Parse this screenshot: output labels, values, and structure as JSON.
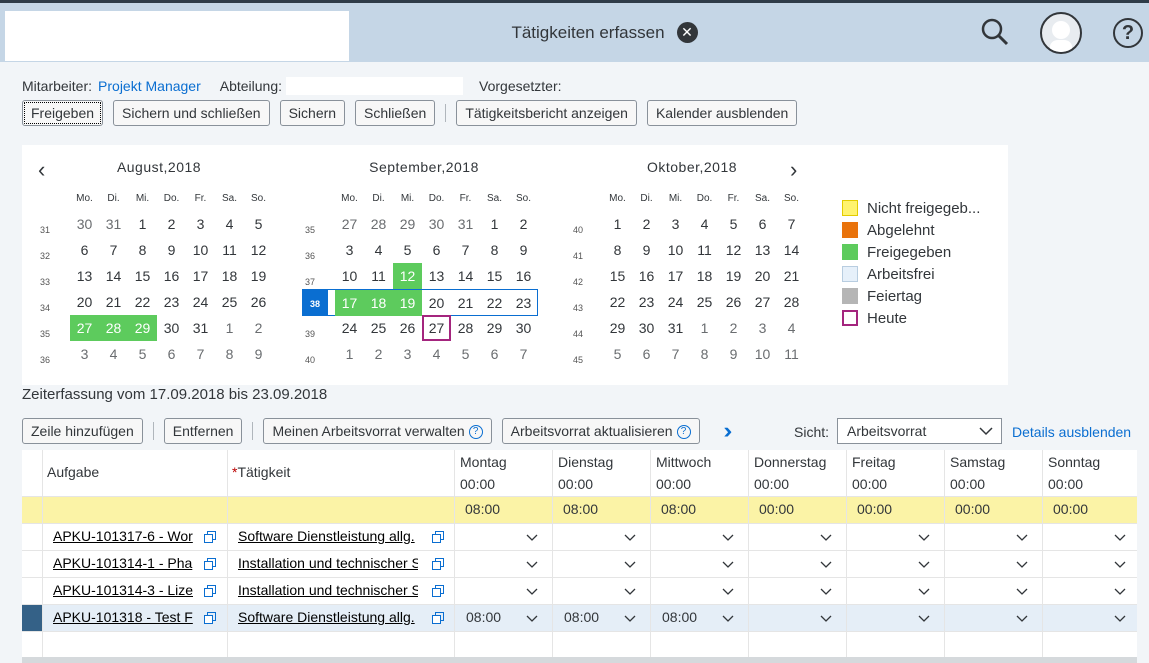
{
  "header": {
    "title": "Tätigkeiten erfassen",
    "icons": [
      "close-icon",
      "search-icon",
      "avatar",
      "help-icon"
    ]
  },
  "info": {
    "employee_label": "Mitarbeiter:",
    "employee_value": "Projekt Manager",
    "department_label": "Abteilung:",
    "supervisor_label": "Vorgesetzter:"
  },
  "toolbar": {
    "release": "Freigeben",
    "save_close": "Sichern und schließen",
    "save": "Sichern",
    "close": "Schließen",
    "report": "Tätigkeitsbericht anzeigen",
    "hide_calendar": "Kalender ausblenden"
  },
  "calendar": {
    "weekday_headers": [
      "Mo.",
      "Di.",
      "Mi.",
      "Do.",
      "Fr.",
      "Sa.",
      "So."
    ],
    "months": [
      {
        "title": "August,2018",
        "weeks": [
          {
            "wk": "31",
            "days": [
              "30",
              "31",
              "1",
              "2",
              "3",
              "4",
              "5"
            ],
            "other": [
              0,
              1
            ]
          },
          {
            "wk": "32",
            "days": [
              "6",
              "7",
              "8",
              "9",
              "10",
              "11",
              "12"
            ],
            "other": []
          },
          {
            "wk": "33",
            "days": [
              "13",
              "14",
              "15",
              "16",
              "17",
              "18",
              "19"
            ],
            "other": []
          },
          {
            "wk": "34",
            "days": [
              "20",
              "21",
              "22",
              "23",
              "24",
              "25",
              "26"
            ],
            "other": []
          },
          {
            "wk": "35",
            "days": [
              "27",
              "28",
              "29",
              "30",
              "31",
              "1",
              "2"
            ],
            "other": [
              5,
              6
            ],
            "green": [
              0,
              1,
              2
            ]
          },
          {
            "wk": "36",
            "days": [
              "3",
              "4",
              "5",
              "6",
              "7",
              "8",
              "9"
            ],
            "other": [
              0,
              1,
              2,
              3,
              4,
              5,
              6
            ]
          }
        ]
      },
      {
        "title": "September,2018",
        "weeks": [
          {
            "wk": "35",
            "days": [
              "27",
              "28",
              "29",
              "30",
              "31",
              "1",
              "2"
            ],
            "other": [
              0,
              1,
              2,
              3,
              4
            ]
          },
          {
            "wk": "36",
            "days": [
              "3",
              "4",
              "5",
              "6",
              "7",
              "8",
              "9"
            ],
            "other": []
          },
          {
            "wk": "37",
            "days": [
              "10",
              "11",
              "12",
              "13",
              "14",
              "15",
              "16"
            ],
            "other": [],
            "green": [
              2
            ]
          },
          {
            "wk": "38",
            "days": [
              "17",
              "18",
              "19",
              "20",
              "21",
              "22",
              "23"
            ],
            "other": [],
            "green": [
              0,
              1,
              2
            ],
            "selected": true
          },
          {
            "wk": "39",
            "days": [
              "24",
              "25",
              "26",
              "27",
              "28",
              "29",
              "30"
            ],
            "other": [],
            "today": 3
          },
          {
            "wk": "40",
            "days": [
              "1",
              "2",
              "3",
              "4",
              "5",
              "6",
              "7"
            ],
            "other": [
              0,
              1,
              2,
              3,
              4,
              5,
              6
            ]
          }
        ]
      },
      {
        "title": "Oktober,2018",
        "weeks": [
          {
            "wk": "40",
            "days": [
              "1",
              "2",
              "3",
              "4",
              "5",
              "6",
              "7"
            ],
            "other": []
          },
          {
            "wk": "41",
            "days": [
              "8",
              "9",
              "10",
              "11",
              "12",
              "13",
              "14"
            ],
            "other": []
          },
          {
            "wk": "42",
            "days": [
              "15",
              "16",
              "17",
              "18",
              "19",
              "20",
              "21"
            ],
            "other": []
          },
          {
            "wk": "43",
            "days": [
              "22",
              "23",
              "24",
              "25",
              "26",
              "27",
              "28"
            ],
            "other": []
          },
          {
            "wk": "44",
            "days": [
              "29",
              "30",
              "31",
              "1",
              "2",
              "3",
              "4"
            ],
            "other": [
              3,
              4,
              5,
              6
            ]
          },
          {
            "wk": "45",
            "days": [
              "5",
              "6",
              "7",
              "8",
              "9",
              "10",
              "11"
            ],
            "other": [
              0,
              1,
              2,
              3,
              4,
              5,
              6
            ]
          }
        ]
      }
    ],
    "legend": [
      {
        "label": "Nicht freigegeb...",
        "color": "#fff36e",
        "border": "#e3cc00"
      },
      {
        "label": "Abgelehnt",
        "color": "#e9730c",
        "border": "#e9730c"
      },
      {
        "label": "Freigegeben",
        "color": "#5dcb5d",
        "border": "#5dcb5d"
      },
      {
        "label": "Arbeitsfrei",
        "color": "#e6f0fa",
        "border": "#b8cde0"
      },
      {
        "label": "Feiertag",
        "color": "#b5b5b5",
        "border": "#b5b5b5"
      },
      {
        "label": "Heute",
        "color": "#ffffff",
        "border": "#a4257e"
      }
    ]
  },
  "period": "Zeiterfassung vom 17.09.2018 bis 23.09.2018",
  "toolbar2": {
    "add_row": "Zeile hinzufügen",
    "remove": "Entfernen",
    "manage": "Meinen Arbeitsvorrat verwalten",
    "refresh": "Arbeitsvorrat aktualisieren",
    "view_label": "Sicht:",
    "view_value": "Arbeitsvorrat",
    "details": "Details ausblenden"
  },
  "table": {
    "col_task": "Aufgabe",
    "col_activity": "Tätigkeit",
    "required_marker": "*",
    "days": [
      {
        "name": "Montag",
        "time": "00:00",
        "target": "08:00"
      },
      {
        "name": "Dienstag",
        "time": "00:00",
        "target": "08:00"
      },
      {
        "name": "Mittwoch",
        "time": "00:00",
        "target": "08:00"
      },
      {
        "name": "Donnerstag",
        "time": "00:00",
        "target": "00:00"
      },
      {
        "name": "Freitag",
        "time": "00:00",
        "target": "00:00"
      },
      {
        "name": "Samstag",
        "time": "00:00",
        "target": "00:00"
      },
      {
        "name": "Sonntag",
        "time": "00:00",
        "target": "00:00"
      }
    ],
    "rows": [
      {
        "task": "APKU-101317-6 - Wor",
        "activity": "Software Dienstleistung allg.",
        "values": [
          "",
          "",
          "",
          "",
          "",
          "",
          ""
        ]
      },
      {
        "task": "APKU-101314-1 - Pha",
        "activity": "Installation und technischer S",
        "values": [
          "",
          "",
          "",
          "",
          "",
          "",
          ""
        ]
      },
      {
        "task": "APKU-101314-3 - Lize",
        "activity": "Installation und technischer S",
        "values": [
          "",
          "",
          "",
          "",
          "",
          "",
          ""
        ]
      },
      {
        "task": "APKU-101318 - Test F",
        "activity": "Software Dienstleistung allg.",
        "values": [
          "08:00",
          "08:00",
          "08:00",
          "",
          "",
          "",
          ""
        ],
        "selected": true
      }
    ]
  }
}
